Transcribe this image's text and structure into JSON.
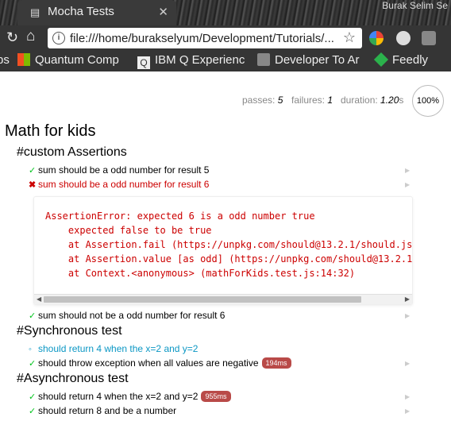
{
  "browser": {
    "tab_title": "Mocha Tests",
    "tab_close": "✕",
    "user_name": "Burak Selim Se",
    "url": "file:///home/burakselyum/Development/Tutorials/...",
    "bookmarks": [
      {
        "label": "ps",
        "icon": "text-fragment"
      },
      {
        "label": "Quantum Comp",
        "icon": "microsoft-icon"
      },
      {
        "label": "IBM Q Experienc",
        "icon": "ibm-q-icon"
      },
      {
        "label": "Developer To Ar",
        "icon": "developer-icon"
      },
      {
        "label": "Feedly",
        "icon": "feedly-icon"
      }
    ],
    "colors": {
      "chrome": "#353535",
      "tabbar": "#2a2a2a"
    }
  },
  "stats": {
    "passes_label": "passes:",
    "passes": "5",
    "failures_label": "failures:",
    "failures": "1",
    "duration_label": "duration:",
    "duration": "1.20",
    "duration_unit": "s",
    "progress": "100%"
  },
  "report": {
    "suite_title": "Math for kids",
    "suites": [
      {
        "title": "#custom Assertions",
        "tests": [
          {
            "status": "pass",
            "mark": "✓",
            "title": "sum should be a odd number for result 5"
          },
          {
            "status": "fail",
            "mark": "✖",
            "title": "sum should be a odd number for result 6"
          },
          {
            "status": "pass",
            "mark": "✓",
            "title": "sum should not be a odd number for result 6"
          }
        ]
      },
      {
        "title": "#Synchronous test",
        "tests": [
          {
            "status": "pending",
            "mark": "◦",
            "title": "should return 4 when the x=2 and y=2"
          },
          {
            "status": "pass",
            "mark": "✓",
            "title": "should throw exception when all values are negative",
            "duration": "194ms"
          }
        ]
      },
      {
        "title": "#Asynchronous test",
        "tests": [
          {
            "status": "pass",
            "mark": "✓",
            "title": "should return 4 when the x=2 and y=2",
            "duration": "955ms"
          },
          {
            "status": "pass",
            "mark": "✓",
            "title": "should return 8 and be a number"
          }
        ]
      }
    ],
    "error_lines": [
      "AssertionError: expected 6 is a odd number true",
      "    expected false to be true",
      "    at Assertion.fail (https://unpkg.com/should@13.2.1/should.js",
      "    at Assertion.value [as odd] (https://unpkg.com/should@13.2.1",
      "    at Context.<anonymous> (mathForKids.test.js:14:32)"
    ],
    "colors": {
      "pass": "#00c41c",
      "fail": "#c00000",
      "pending": "#0b97c4",
      "duration_badge": "#b94a48"
    }
  }
}
